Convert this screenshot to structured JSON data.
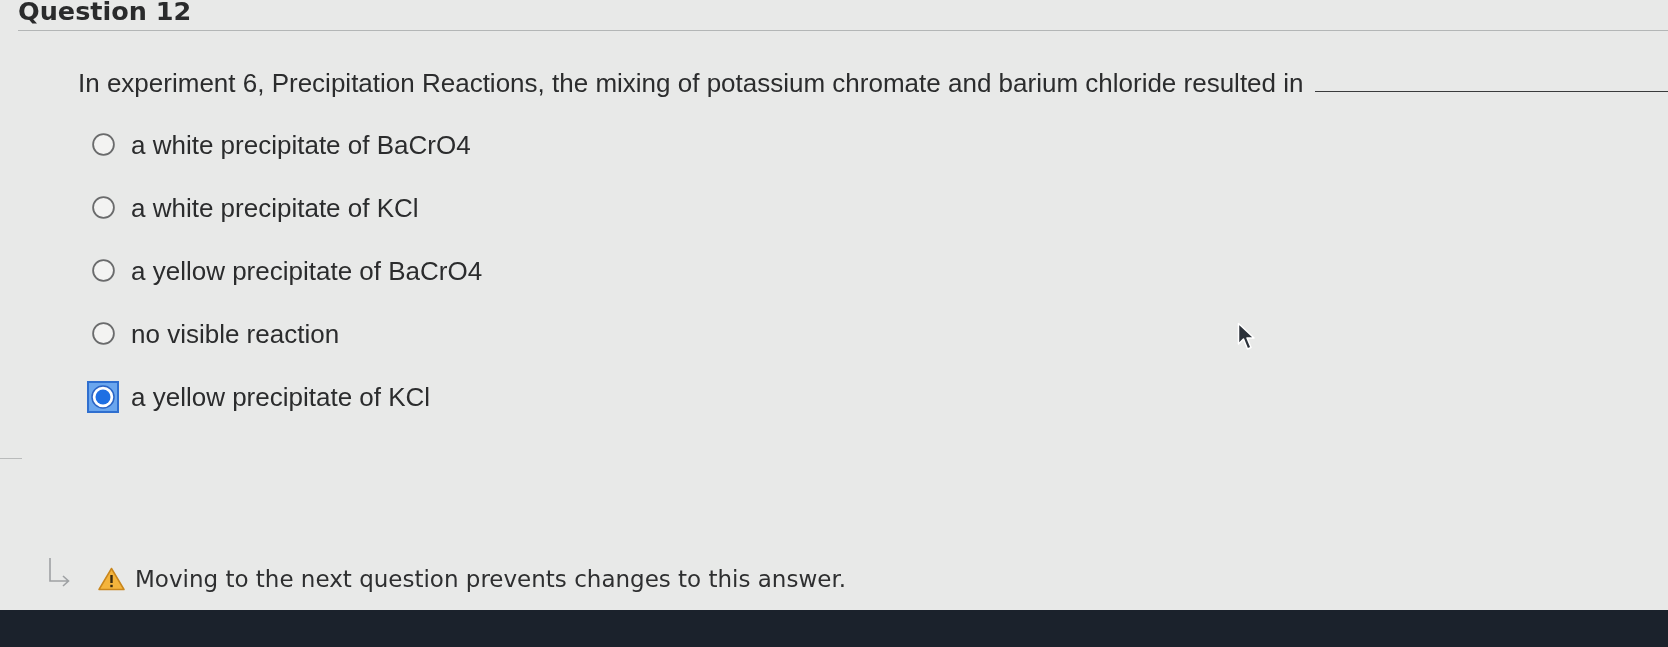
{
  "question": {
    "title": "Question 12",
    "prompt": "In experiment 6, Precipitation Reactions, the mixing of potassium chromate and barium chloride resulted in"
  },
  "options": [
    {
      "label": "a white precipitate of BaCrO4",
      "selected": false
    },
    {
      "label": "a white precipitate of KCl",
      "selected": false
    },
    {
      "label": "a yellow precipitate of BaCrO4",
      "selected": false
    },
    {
      "label": "no visible reaction",
      "selected": false
    },
    {
      "label": "a yellow precipitate of KCl",
      "selected": true
    }
  ],
  "notice": {
    "text": "Moving to the next question prevents changes to this answer."
  }
}
